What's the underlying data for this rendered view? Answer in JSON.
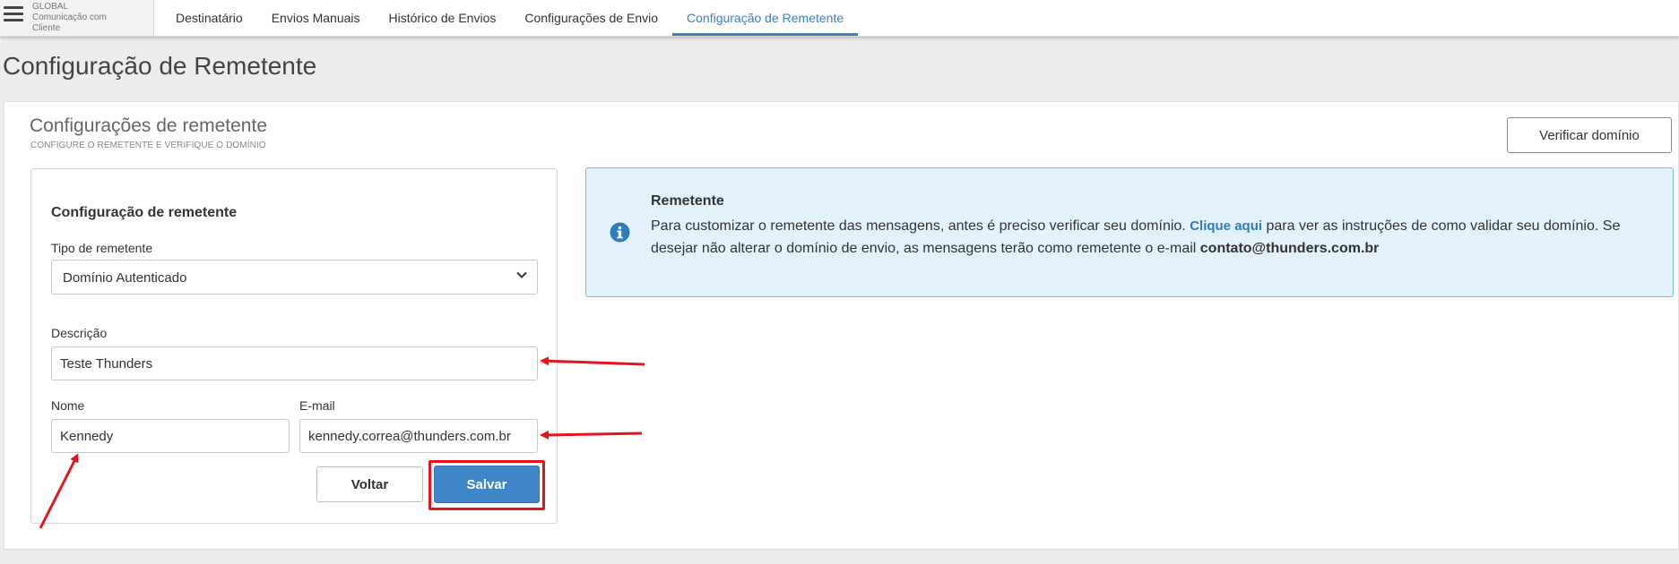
{
  "brand": {
    "line1": "GLOBAL",
    "line2": "Comunicação com",
    "line3": "Cliente"
  },
  "nav": {
    "tabs": [
      {
        "label": "Destinatário"
      },
      {
        "label": "Envios Manuais"
      },
      {
        "label": "Histórico de Envios"
      },
      {
        "label": "Configurações de Envio"
      },
      {
        "label": "Configuração de Remetente"
      }
    ],
    "active_index": 4
  },
  "page": {
    "title": "Configuração de Remetente"
  },
  "card": {
    "title": "Configurações de remetente",
    "subtitle": "CONFIGURE O REMETENTE E VERIFIQUE O DOMÍNIO",
    "verify_button": "Verificar domínio"
  },
  "form": {
    "heading": "Configuração de remetente",
    "sender_type_label": "Tipo de remetente",
    "sender_type_value": "Domínio Autenticado",
    "description_label": "Descrição",
    "description_value": "Teste Thunders",
    "name_label": "Nome",
    "name_value": "Kennedy",
    "email_label": "E-mail",
    "email_value": "kennedy.correa@thunders.com.br",
    "back_button": "Voltar",
    "save_button": "Salvar"
  },
  "info": {
    "title": "Remetente",
    "text_before_link": "Para customizar o remetente das mensagens, antes é preciso verificar seu domínio. ",
    "link": "Clique aqui",
    "text_after_link": " para ver as instruções de como validar seu domínio. Se desejar não alterar o domínio de envio, as mensagens terão como remetente o e-mail ",
    "email": "contato@thunders.com.br"
  },
  "icons": {
    "menu": "hamburger-menu-icon",
    "select_arrow": "chevron-down-icon",
    "info": "info-circle-icon"
  },
  "colors": {
    "accent": "#3b7fc4",
    "save_button": "#3f86c8",
    "info_background": "#e3f1fb",
    "info_border": "#77b7e2",
    "annotation": "#e8141d"
  }
}
